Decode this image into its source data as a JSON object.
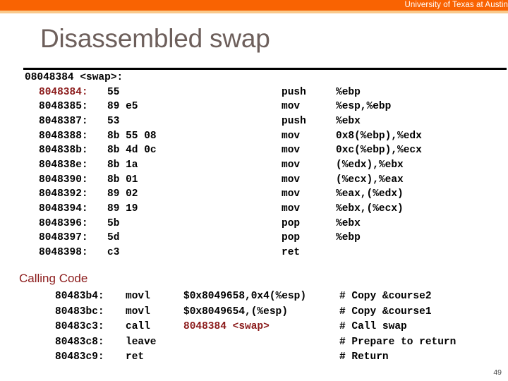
{
  "banner": {
    "university": "University of Texas at Austin",
    "bar_color": "#f96302",
    "underline_color": "#f9c98b"
  },
  "title": {
    "text": "Disassembled swap",
    "color": "#6d5f5b"
  },
  "disassembly": {
    "header": "08048384 <swap>:",
    "highlight_color": "#8b1a1a",
    "rows": [
      {
        "addr": "8048384:",
        "bytes": "55",
        "mnem": "push",
        "ops": "%ebp",
        "addr_highlight": true
      },
      {
        "addr": "8048385:",
        "bytes": "89 e5",
        "mnem": "mov",
        "ops": "%esp,%ebp",
        "addr_highlight": false
      },
      {
        "addr": "8048387:",
        "bytes": "53",
        "mnem": "push",
        "ops": "%ebx",
        "addr_highlight": false
      },
      {
        "addr": "8048388:",
        "bytes": "8b 55 08",
        "mnem": "mov",
        "ops": "0x8(%ebp),%edx",
        "addr_highlight": false
      },
      {
        "addr": "804838b:",
        "bytes": "8b 4d 0c",
        "mnem": "mov",
        "ops": "0xc(%ebp),%ecx",
        "addr_highlight": false
      },
      {
        "addr": "804838e:",
        "bytes": "8b 1a",
        "mnem": "mov",
        "ops": "(%edx),%ebx",
        "addr_highlight": false
      },
      {
        "addr": "8048390:",
        "bytes": "8b 01",
        "mnem": "mov",
        "ops": "(%ecx),%eax",
        "addr_highlight": false
      },
      {
        "addr": "8048392:",
        "bytes": "89 02",
        "mnem": "mov",
        "ops": "%eax,(%edx)",
        "addr_highlight": false
      },
      {
        "addr": "8048394:",
        "bytes": "89 19",
        "mnem": "mov",
        "ops": "%ebx,(%ecx)",
        "addr_highlight": false
      },
      {
        "addr": "8048396:",
        "bytes": "5b",
        "mnem": "pop",
        "ops": "%ebx",
        "addr_highlight": false
      },
      {
        "addr": "8048397:",
        "bytes": "5d",
        "mnem": "pop",
        "ops": "%ebp",
        "addr_highlight": false
      },
      {
        "addr": "8048398:",
        "bytes": "c3",
        "mnem": "ret",
        "ops": "",
        "addr_highlight": false
      }
    ]
  },
  "calling_code": {
    "label": "Calling Code",
    "label_color": "#8b1a1a",
    "rows": [
      {
        "addr": "80483b4:",
        "mnem": "movl",
        "ops": "$0x8049658,0x4(%esp)",
        "ops_highlight": false,
        "comment": "# Copy &course2"
      },
      {
        "addr": "80483bc:",
        "mnem": "movl",
        "ops": "$0x8049654,(%esp)",
        "ops_highlight": false,
        "comment": "# Copy &course1"
      },
      {
        "addr": "80483c3:",
        "mnem": "call",
        "ops": "8048384 <swap>",
        "ops_highlight": true,
        "comment": "# Call swap"
      },
      {
        "addr": "80483c8:",
        "mnem": "leave",
        "ops": "",
        "ops_highlight": false,
        "comment": "# Prepare to return"
      },
      {
        "addr": "80483c9:",
        "mnem": "ret",
        "ops": "",
        "ops_highlight": false,
        "comment": "# Return"
      }
    ]
  },
  "footer": {
    "page_number": "49"
  }
}
